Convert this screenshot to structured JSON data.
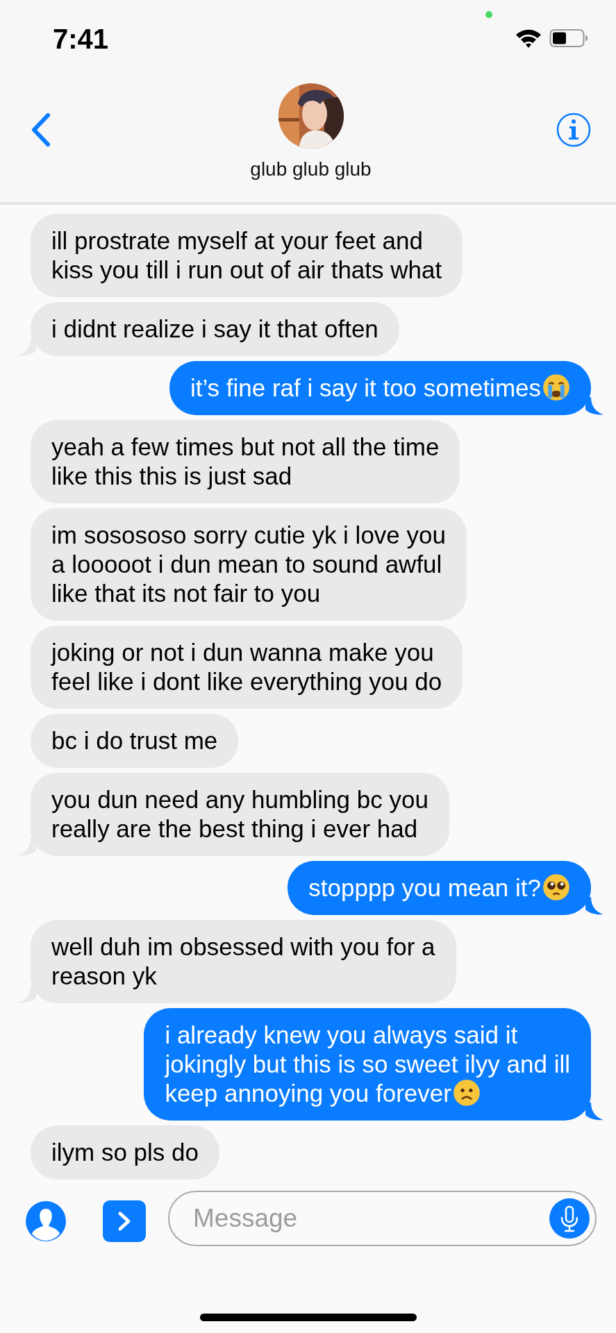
{
  "status_bar": {
    "time": "7:41"
  },
  "header": {
    "contact_name": "glub glub glub"
  },
  "messages": [
    {
      "sent": false,
      "text": "ill prostrate myself at your feet and\nkiss you till i run out of air thats what",
      "tail": false
    },
    {
      "sent": false,
      "text": "i didnt realize i say it that often",
      "tail": true
    },
    {
      "sent": true,
      "text": "it’s fine raf i say it too sometimes",
      "emoji": {
        "kind": "crying"
      },
      "tail": true
    },
    {
      "sent": false,
      "text": "yeah a few times but not all the time\nlike this this is just sad",
      "tail": false
    },
    {
      "sent": false,
      "text": "im sosososo sorry cutie yk i love you\na looooot i dun mean to sound awful\nlike that its not fair to you",
      "tail": false
    },
    {
      "sent": false,
      "text": "joking or not i dun wanna make you\nfeel like i dont like everything you do",
      "tail": false
    },
    {
      "sent": false,
      "text": "bc i do trust me",
      "tail": false
    },
    {
      "sent": false,
      "text": "you dun need any humbling bc you\nreally are the best thing i ever had",
      "tail": true
    },
    {
      "sent": true,
      "text": "stopppp you mean it?",
      "emoji": {
        "kind": "pleading"
      },
      "tail": true
    },
    {
      "sent": false,
      "text": "well duh im obsessed with you for a\nreason yk",
      "tail": true
    },
    {
      "sent": true,
      "text": "i already knew you always said it\njokingly but this is so sweet ilyy and ill\nkeep annoying you forever",
      "emoji": {
        "kind": "frowning"
      },
      "tail": true
    },
    {
      "sent": false,
      "text": "ilym so pls do",
      "tail": false
    }
  ],
  "composer": {
    "placeholder": "Message"
  }
}
